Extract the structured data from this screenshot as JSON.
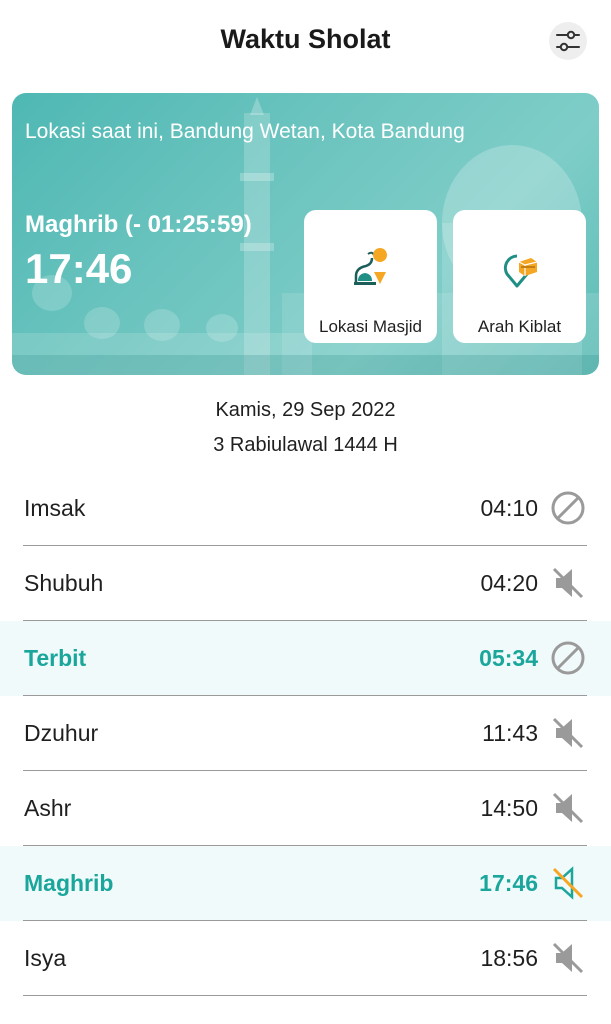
{
  "app_bar": {
    "title": "Waktu Sholat",
    "settings_icon": "sliders-icon"
  },
  "hero": {
    "location": "Lokasi saat ini, Bandung Wetan, Kota Bandung",
    "next_prayer": "Maghrib (- 01:25:59)",
    "next_time": "17:46",
    "tiles": [
      {
        "label": "Lokasi Masjid",
        "icon": "mosque-location-icon"
      },
      {
        "label": "Arah Kiblat",
        "icon": "kaaba-direction-icon"
      }
    ]
  },
  "dates": {
    "gregorian": "Kamis, 29 Sep 2022",
    "hijri": "3 Rabiulawal 1444 H"
  },
  "colors": {
    "accent": "#1aa69b",
    "active_row_bg": "#f0fafb",
    "icon_gray": "#9a9a9a",
    "alert_orange": "#f5a623"
  },
  "prayers": [
    {
      "name": "Imsak",
      "time": "04:10",
      "icon": "disabled-icon",
      "active": false
    },
    {
      "name": "Shubuh",
      "time": "04:20",
      "icon": "speaker-muted-icon",
      "active": false
    },
    {
      "name": "Terbit",
      "time": "05:34",
      "icon": "disabled-icon",
      "active": true
    },
    {
      "name": "Dzuhur",
      "time": "11:43",
      "icon": "speaker-muted-icon",
      "active": false
    },
    {
      "name": "Ashr",
      "time": "14:50",
      "icon": "speaker-muted-icon",
      "active": false
    },
    {
      "name": "Maghrib",
      "time": "17:46",
      "icon": "speaker-muted-highlight-icon",
      "active": true
    },
    {
      "name": "Isya",
      "time": "18:56",
      "icon": "speaker-muted-icon",
      "active": false
    }
  ]
}
